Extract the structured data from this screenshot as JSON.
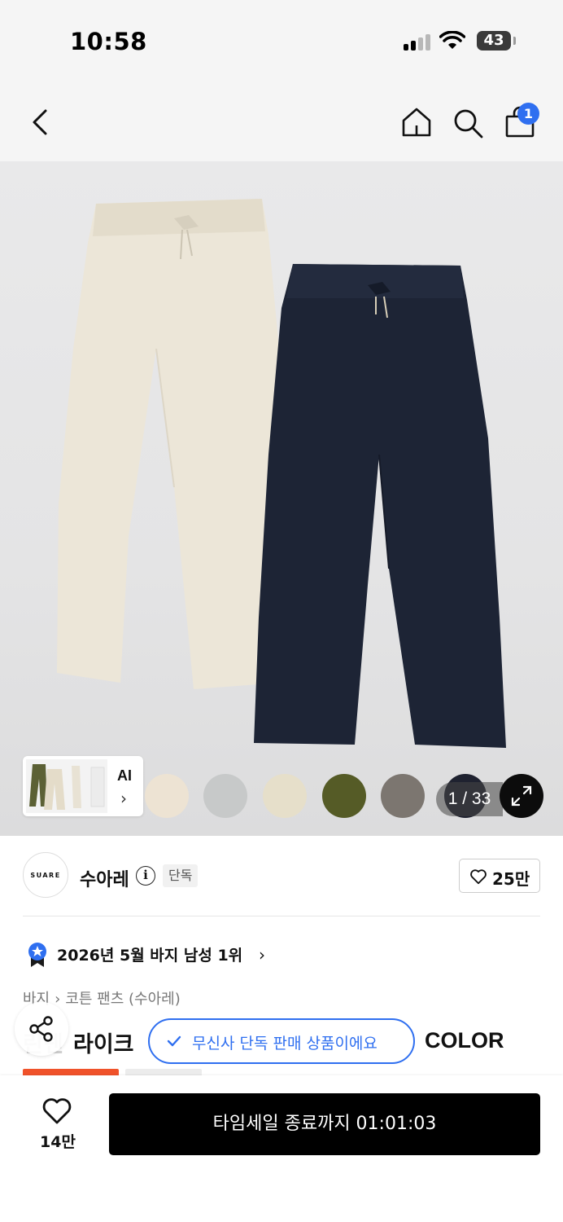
{
  "status_bar": {
    "time": "10:58",
    "battery": "43"
  },
  "nav": {
    "cart_count": "1"
  },
  "gallery": {
    "ai_label": "AI",
    "page_counter": "1 / 33",
    "swatches": [
      "#ede3d3",
      "#c7c9c9",
      "#e6dfca",
      "#555b26",
      "#7c7670"
    ]
  },
  "brand": {
    "logo_text": "SUARE",
    "name": "수아레",
    "badge": "단독",
    "likes": "25만"
  },
  "ranking": {
    "text": "2026년 5월 바지 남성 1위"
  },
  "breadcrumb": {
    "level1": "바지",
    "level2": "코튼 팬츠 (수아레)"
  },
  "product": {
    "title_left_faded": "린넨",
    "title_left": "라이크",
    "title_right": "COLOR"
  },
  "toast": {
    "text": "무신사 단독 판매 상품이에요"
  },
  "bottom": {
    "wish_count": "14만",
    "buy_label": "타임세일 종료까지 01:01:03"
  },
  "colors": {
    "accent": "#2f6ff0",
    "sale": "#f0522a"
  }
}
